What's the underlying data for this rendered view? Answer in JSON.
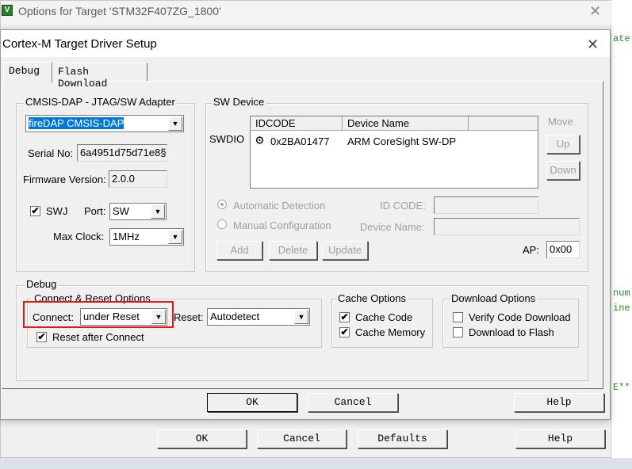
{
  "outer_window": {
    "title": "Options for Target 'STM32F407ZG_1800'",
    "icon_letter": "V",
    "buttons": {
      "ok": "OK",
      "cancel": "Cancel",
      "defaults": "Defaults",
      "help": "Help"
    }
  },
  "editor_snippets": {
    "line1": "ate",
    "line2": "num",
    "line3": "ine",
    "line4": "E**"
  },
  "dialog": {
    "title": "Cortex-M Target Driver Setup",
    "tabs": [
      {
        "label": "Debug",
        "active": true
      },
      {
        "label": "Flash Download",
        "active": false
      }
    ],
    "adapter": {
      "group_label": "CMSIS-DAP - JTAG/SW Adapter",
      "selected": "fireDAP CMSIS-DAP",
      "serial_label": "Serial No:",
      "serial_value": "6a4951d75d71e8§",
      "firmware_label": "Firmware Version:",
      "firmware_value": "2.0.0",
      "swj_label": "SWJ",
      "swj_checked": true,
      "port_label": "Port:",
      "port_value": "SW",
      "maxclock_label": "Max Clock:",
      "maxclock_value": "1MHz"
    },
    "sw_device": {
      "group_label": "SW Device",
      "swdio_label": "SWDIO",
      "columns": [
        "IDCODE",
        "Device Name"
      ],
      "rows": [
        {
          "idcode": "0x2BA01477",
          "device_name": "ARM CoreSight SW-DP"
        }
      ],
      "move_label": "Move",
      "up_label": "Up",
      "down_label": "Down",
      "auto_detect_label": "Automatic Detection",
      "manual_config_label": "Manual Configuration",
      "id_code_label": "ID CODE:",
      "device_name_label": "Device Name:",
      "add_label": "Add",
      "delete_label": "Delete",
      "update_label": "Update",
      "ap_label": "AP:",
      "ap_value": "0x00"
    },
    "debug": {
      "group_label": "Debug",
      "connect_reset": {
        "group_label": "Connect & Reset Options",
        "connect_label": "Connect:",
        "connect_value": "under Reset",
        "reset_label": "Reset:",
        "reset_value": "Autodetect",
        "reset_after_connect_label": "Reset after Connect",
        "reset_after_connect_checked": true
      },
      "cache": {
        "group_label": "Cache Options",
        "cache_code_label": "Cache Code",
        "cache_code_checked": true,
        "cache_memory_label": "Cache Memory",
        "cache_memory_checked": true
      },
      "download": {
        "group_label": "Download Options",
        "verify_label": "Verify Code Download",
        "verify_checked": false,
        "download_flash_label": "Download to Flash",
        "download_flash_checked": false
      }
    },
    "buttons": {
      "ok": "OK",
      "cancel": "Cancel",
      "help": "Help"
    }
  },
  "colors": {
    "highlight": "#0078d7",
    "annotation_box": "#e01818",
    "editor_text": "#2a8a2a"
  }
}
